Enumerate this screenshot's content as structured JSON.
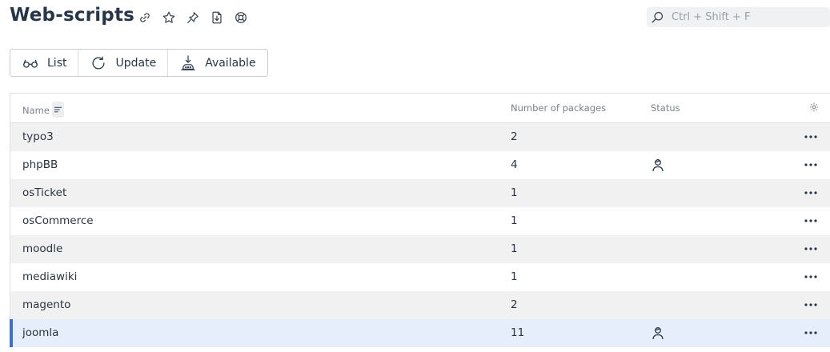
{
  "page": {
    "title": "Web-scripts",
    "title_icons": [
      "link-icon",
      "star-icon",
      "pin-icon",
      "export-icon",
      "help-icon"
    ]
  },
  "search": {
    "placeholder": "Ctrl + Shift + F",
    "value": ""
  },
  "toolbar": {
    "list_label": "List",
    "update_label": "Update",
    "available_label": "Available"
  },
  "table": {
    "columns": {
      "name": "Name",
      "packages": "Number of packages",
      "status": "Status"
    },
    "rows": [
      {
        "name": "typo3",
        "packages": "2",
        "status_icon": null,
        "selected": false
      },
      {
        "name": "phpBB",
        "packages": "4",
        "status_icon": "user-icon",
        "selected": false
      },
      {
        "name": "osTicket",
        "packages": "1",
        "status_icon": null,
        "selected": false
      },
      {
        "name": "osCommerce",
        "packages": "1",
        "status_icon": null,
        "selected": false
      },
      {
        "name": "moodle",
        "packages": "1",
        "status_icon": null,
        "selected": false
      },
      {
        "name": "mediawiki",
        "packages": "1",
        "status_icon": null,
        "selected": false
      },
      {
        "name": "magento",
        "packages": "2",
        "status_icon": null,
        "selected": false
      },
      {
        "name": "joomla",
        "packages": "11",
        "status_icon": "user-icon",
        "selected": true
      }
    ]
  },
  "colors": {
    "title": "#26364a",
    "row_alt": "#f1f1f1",
    "selected_row": "#e6eefc",
    "selected_accent": "#3b6fd6"
  }
}
